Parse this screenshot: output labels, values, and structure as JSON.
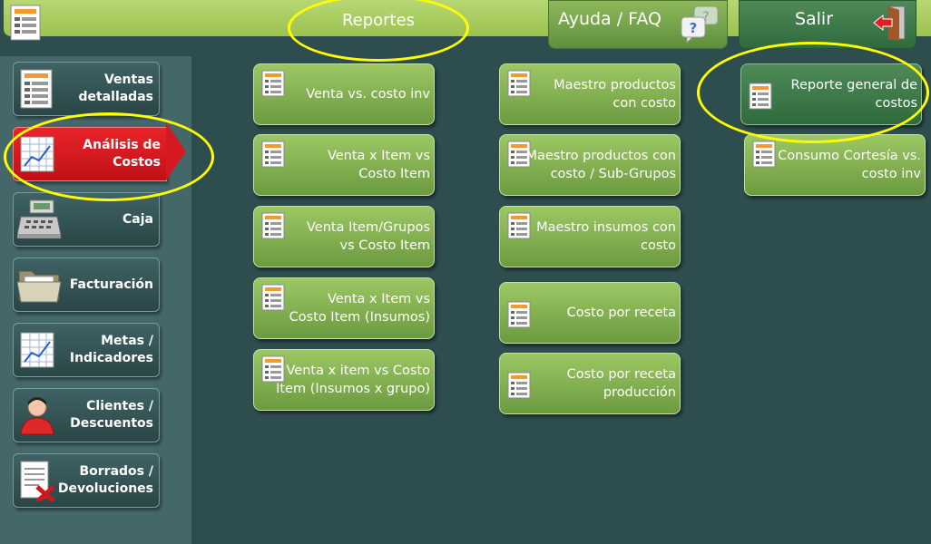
{
  "topbar": {
    "title": "Reportes",
    "help_label": "Ayuda / FAQ",
    "exit_label": "Salir"
  },
  "sidebar": {
    "items": [
      {
        "label": "Ventas detalladas"
      },
      {
        "label": "Análisis de Costos"
      },
      {
        "label": "Caja"
      },
      {
        "label": "Facturación"
      },
      {
        "label": "Metas / Indicadores"
      },
      {
        "label": "Clientes / Descuentos"
      },
      {
        "label": "Borrados / Devoluciones"
      }
    ],
    "active_index": 1
  },
  "reports": {
    "col1": [
      {
        "label": "Venta vs. costo inv"
      },
      {
        "label": "Venta x Item vs\nCosto Item"
      },
      {
        "label": "Venta Item/Grupos\nvs Costo Item"
      },
      {
        "label": "Venta x Item vs\nCosto Item (Insumos)"
      },
      {
        "label": "Venta x item vs  Costo\nItem (Insumos x grupo)"
      }
    ],
    "col2": [
      {
        "label": "Maestro productos\ncon costo"
      },
      {
        "label": "Maestro productos con\ncosto / Sub-Grupos"
      },
      {
        "label": "Maestro insumos  con\ncosto"
      },
      {
        "label": "Costo por receta"
      },
      {
        "label": "Costo por receta\nproducción"
      }
    ],
    "col3": [
      {
        "label": "Reporte general de\ncostos"
      },
      {
        "label": "Consumo Cortesía vs.\ncosto inv"
      }
    ]
  },
  "colors": {
    "background": "#2e4d4f",
    "sidebar": "#44686a",
    "green_button": "#8ab957",
    "active_red": "#d41a20",
    "highlight": "#ffff00"
  }
}
